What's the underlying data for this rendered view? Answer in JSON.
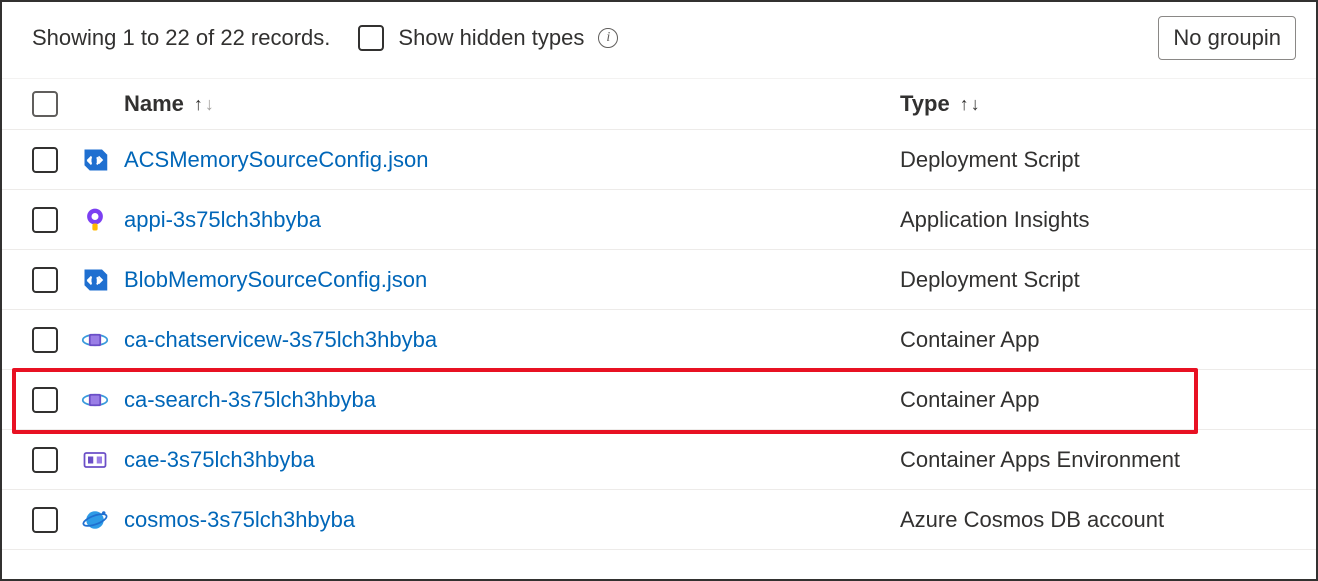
{
  "toolbar": {
    "status": "Showing 1 to 22 of 22 records.",
    "show_hidden_label": "Show hidden types",
    "grouping_label": "No groupin"
  },
  "columns": {
    "name": "Name",
    "type": "Type"
  },
  "rows": [
    {
      "name": "ACSMemorySourceConfig.json",
      "type": "Deployment Script",
      "icon": "script"
    },
    {
      "name": "appi-3s75lch3hbyba",
      "type": "Application Insights",
      "icon": "appinsights"
    },
    {
      "name": "BlobMemorySourceConfig.json",
      "type": "Deployment Script",
      "icon": "script"
    },
    {
      "name": "ca-chatservicew-3s75lch3hbyba",
      "type": "Container App",
      "icon": "containerapp"
    },
    {
      "name": "ca-search-3s75lch3hbyba",
      "type": "Container App",
      "icon": "containerapp",
      "highlight": true
    },
    {
      "name": "cae-3s75lch3hbyba",
      "type": "Container Apps Environment",
      "icon": "containerenv"
    },
    {
      "name": "cosmos-3s75lch3hbyba",
      "type": "Azure Cosmos DB account",
      "icon": "cosmos"
    }
  ]
}
